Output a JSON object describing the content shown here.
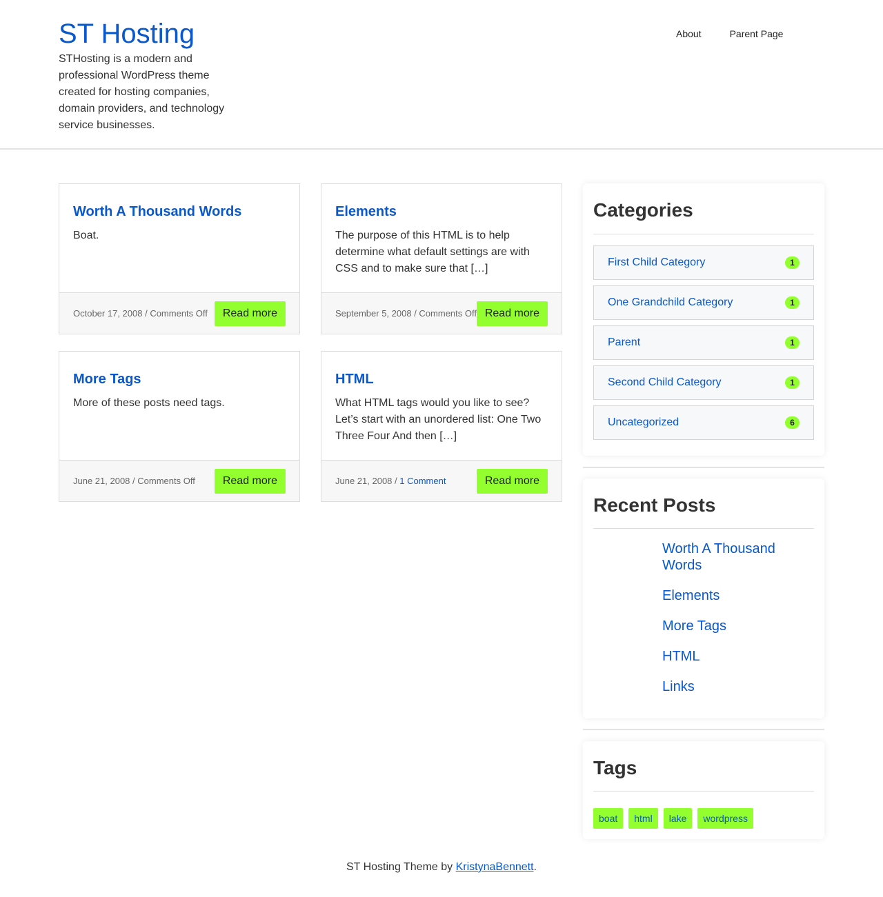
{
  "header": {
    "site_title": "ST Hosting",
    "site_description": "STHosting is a modern and professional WordPress theme created for hosting companies, domain providers, and technology service businesses.",
    "nav": [
      {
        "label": "About"
      },
      {
        "label": "Parent Page"
      }
    ]
  },
  "posts": [
    {
      "title": "Worth A Thousand Words",
      "excerpt": "Boat.",
      "date": "October 17, 2008",
      "separator": " / ",
      "comments": "Comments Off",
      "read_more": "Read more"
    },
    {
      "title": "Elements",
      "excerpt": "The purpose of this HTML is to help determine what default settings are with CSS and to make sure that […]",
      "date": "September 5, 2008",
      "separator": " / ",
      "comments": "Comments Off",
      "read_more": "Read more"
    },
    {
      "title": "More Tags",
      "excerpt": "More of these posts need tags.",
      "date": "June 21, 2008",
      "separator": " / ",
      "comments": "Comments Off",
      "read_more": "Read more"
    },
    {
      "title": "HTML",
      "excerpt": "What HTML tags would you like to see? Let’s start with an unordered list: One Two Three Four And then […]",
      "date": "June 21, 2008",
      "separator": " / ",
      "comments": "1 Comment",
      "read_more": "Read more"
    }
  ],
  "sidebar": {
    "categories": {
      "title": "Categories",
      "items": [
        {
          "name": "First Child Category",
          "count": "1"
        },
        {
          "name": "One Grandchild Category",
          "count": "1"
        },
        {
          "name": "Parent",
          "count": "1"
        },
        {
          "name": "Second Child Category",
          "count": "1"
        },
        {
          "name": "Uncategorized",
          "count": "6"
        }
      ]
    },
    "recent_posts": {
      "title": "Recent Posts",
      "items": [
        "Worth A Thousand Words",
        "Elements",
        "More Tags",
        "HTML",
        "Links"
      ]
    },
    "tags": {
      "title": "Tags",
      "items": [
        "boat",
        "html",
        "lake",
        "wordpress"
      ]
    }
  },
  "footer": {
    "text": "ST Hosting Theme by ",
    "link": "KristynaBennett",
    "end": "."
  },
  "colors": {
    "link": "#0a58ca",
    "accent": "#94ff2e",
    "text": "#333333"
  }
}
